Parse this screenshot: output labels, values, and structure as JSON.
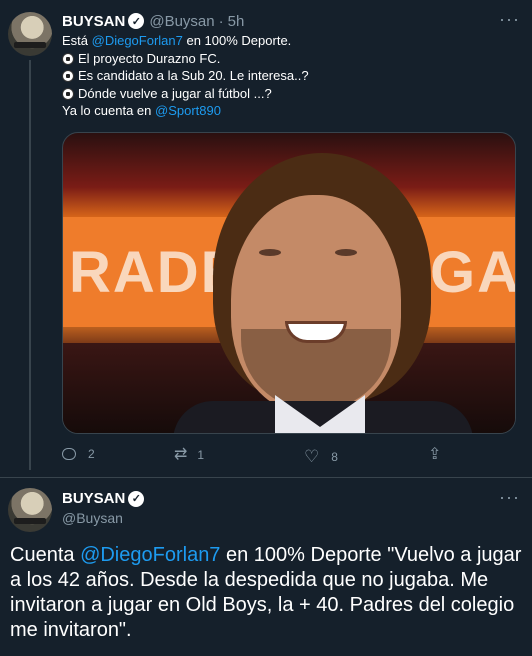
{
  "tweet1": {
    "display_name": "BUYSAN",
    "handle": "@Buysan",
    "separator": "·",
    "time": "5h",
    "more_label": "···",
    "lines": [
      {
        "pre": "Está ",
        "mention": "@DiegoForlan7",
        "post": " en 100% Deporte."
      },
      {
        "text": "El proyecto Durazno FC."
      },
      {
        "text": "Es candidato a la Sub 20. Le interesa..?"
      },
      {
        "text": "Dónde vuelve a jugar al fútbol ...?"
      },
      {
        "pre": "Ya lo cuenta en ",
        "mention": "@Sport890",
        "post": ""
      }
    ],
    "image_banner_left": "RADE",
    "image_banner_right": "GA",
    "replies": "2",
    "retweets": "1",
    "likes": "8"
  },
  "tweet2": {
    "display_name": "BUYSAN",
    "handle": "@Buysan",
    "text_pre": "Cuenta ",
    "mention": "@DiegoForlan7",
    "text_post": " en 100% Deporte \"Vuelvo a jugar a los 42 años. Desde la despedida que no jugaba. Me invitaron a jugar en Old Boys, la + 40. Padres del colegio me invitaron\"."
  },
  "icons": {
    "verified": "verified-badge-icon",
    "soccer_ball": "soccer-ball-icon",
    "reply": "reply-icon",
    "retweet": "retweet-icon",
    "like": "heart-icon",
    "share": "share-icon",
    "more": "more-options-icon"
  },
  "colors": {
    "background": "#15202b",
    "text": "#ffffff",
    "secondary": "#8899a6",
    "accent": "#1d9bf0",
    "divider": "#38444d"
  }
}
